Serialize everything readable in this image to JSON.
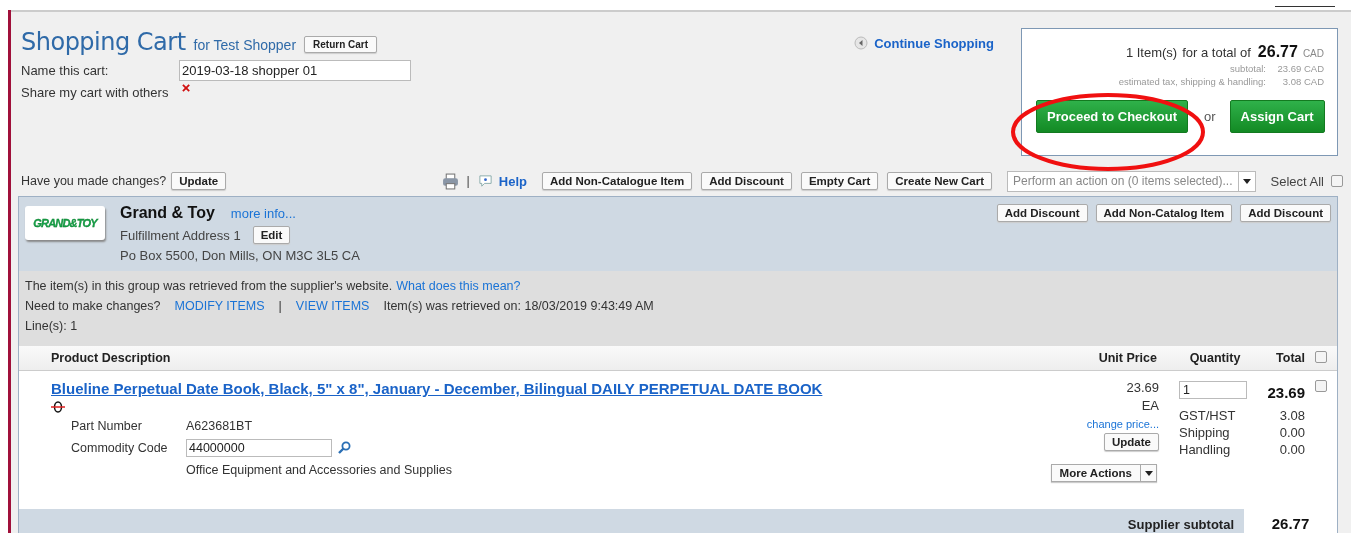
{
  "cart": {
    "title": "Shopping Cart",
    "owner": "for Test Shopper",
    "return_button": "Return Cart",
    "name_label": "Name this cart:",
    "name_value": "2019-03-18 shopper 01",
    "share_label": "Share my cart with others",
    "shared": false
  },
  "continue_link": "Continue Shopping",
  "summary": {
    "items": "1 Item(s)",
    "total_label": "for a total of",
    "total": "26.77",
    "currency": "CAD",
    "subtotal_label": "subtotal:",
    "subtotal": "23.69 CAD",
    "tax_label": "estimated tax, shipping & handling:",
    "tax": "3.08 CAD",
    "checkout_button": "Proceed to Checkout",
    "or": "or",
    "assign_button": "Assign Cart"
  },
  "toolbar": {
    "changes_label": "Have you made changes?",
    "update_button": "Update",
    "separator": "|",
    "help": "Help",
    "buttons": [
      "Add Non-Catalogue Item",
      "Add Discount",
      "Empty Cart",
      "Create New Cart"
    ],
    "action_placeholder": "Perform an action on (0 items selected)...",
    "select_all": "Select All",
    "select_all_checked": false
  },
  "supplier": {
    "logo": "GRAND&TOY",
    "name": "Grand & Toy",
    "more_info": "more info...",
    "address_label": "Fulfillment Address 1",
    "edit_button": "Edit",
    "address": "Po Box 5500, Don Mills, ON M3C 3L5 CA",
    "buttons": [
      "Add Discount",
      "Add Non-Catalog Item",
      "Add Discount"
    ],
    "notice": "The item(s) in this group was retrieved from the supplier's website.",
    "notice_link": "What does this mean?",
    "changes_label": "Need to make changes?",
    "links": [
      "MODIFY ITEMS",
      "VIEW ITEMS"
    ],
    "link_separator": "|",
    "retrieved": "Item(s) was retrieved on: 18/03/2019 9:43:49 AM",
    "lines": "Line(s): 1"
  },
  "table": {
    "columns": [
      "Product Description",
      "Unit Price",
      "Quantity",
      "Total"
    ],
    "all_checked": false,
    "rows": [
      {
        "title": "Blueline Perpetual Date Book, Black, 5\" x 8\", January - December, Bilingual DAILY PERPETUAL DATE BOOK",
        "part_label": "Part Number",
        "part": "A623681BT",
        "commodity_label": "Commodity Code",
        "commodity": "44000000",
        "commodity_desc": "Office Equipment and Accessories and Supplies",
        "unit_price": "23.69",
        "unit": "EA",
        "change_price": "change price...",
        "update_button": "Update",
        "more_actions": "More Actions",
        "quantity": "1",
        "total": "23.69",
        "checked": false,
        "charges": [
          {
            "label": "GST/HST",
            "value": "3.08"
          },
          {
            "label": "Shipping",
            "value": "0.00"
          },
          {
            "label": "Handling",
            "value": "0.00"
          }
        ]
      }
    ],
    "subtotal_label": "Supplier subtotal",
    "subtotal": "26.77"
  }
}
